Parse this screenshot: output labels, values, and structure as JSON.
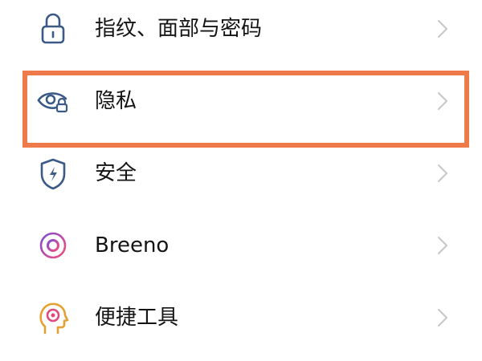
{
  "settings_list": {
    "items": [
      {
        "label": "指纹、面部与密码",
        "icon": "lock-icon"
      },
      {
        "label": "隐私",
        "icon": "privacy-eye-lock-icon"
      },
      {
        "label": "安全",
        "icon": "security-shield-icon"
      },
      {
        "label": "Breeno",
        "icon": "breeno-ring-icon"
      },
      {
        "label": "便捷工具",
        "icon": "head-gear-icon"
      }
    ]
  },
  "highlight": {
    "color": "#ee7a4a",
    "target": "隐私"
  },
  "colors": {
    "icon_blue": "#3b5a86",
    "icon_purple": "#a24fc0",
    "icon_pink": "#e0497c",
    "icon_orange": "#e6a030",
    "chevron": "#c7c7c7",
    "text": "#141414"
  }
}
